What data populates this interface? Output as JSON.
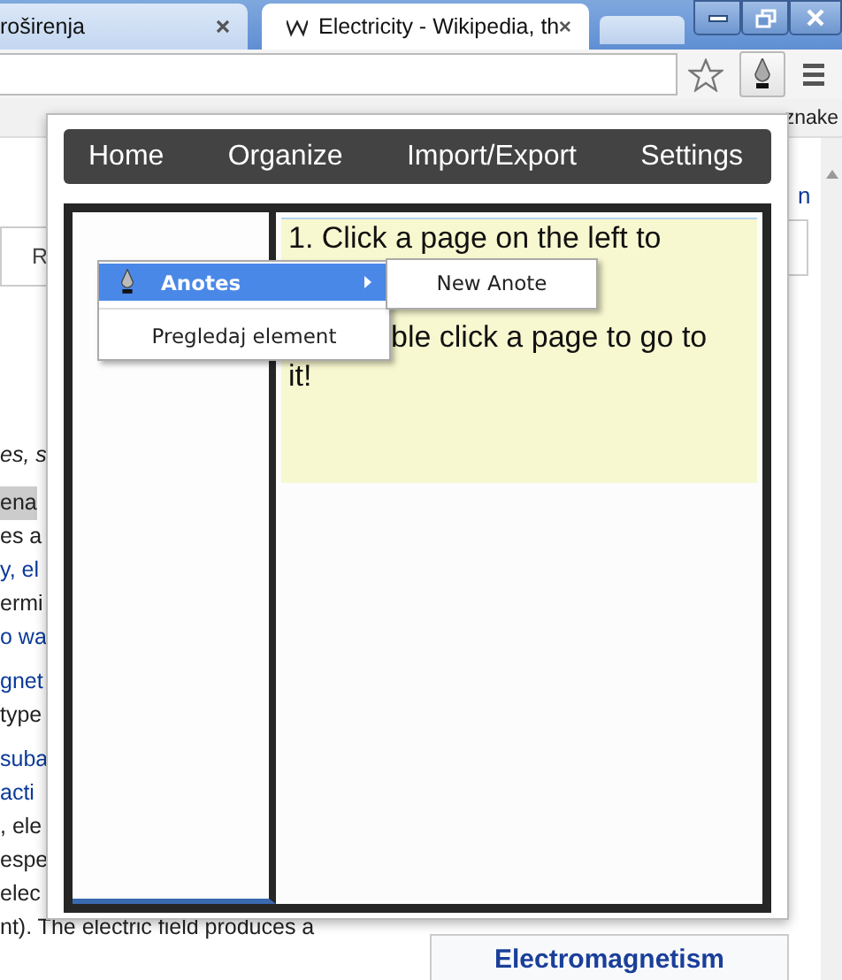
{
  "browser": {
    "tabs": [
      {
        "title": "roširenja",
        "selected": false
      },
      {
        "title": "Electricity - Wikipedia, th",
        "selected": true
      }
    ],
    "bookmarks_bar": {
      "item": "znake"
    }
  },
  "page": {
    "fragments": [
      {
        "text": "R",
        "kind": "box"
      },
      {
        "text": "es, s",
        "kind": "italic"
      },
      {
        "text": "ena",
        "kind": "highlight"
      },
      {
        "text": "es a",
        "kind": "text"
      },
      {
        "text": "y, el",
        "kind": "link"
      },
      {
        "text": "ermi",
        "kind": "text"
      },
      {
        "text": "o wa",
        "kind": "link"
      },
      {
        "text": "gnet",
        "kind": "link"
      },
      {
        "text": "type",
        "kind": "text"
      },
      {
        "text": "suba",
        "kind": "link"
      },
      {
        "text": "acti",
        "kind": "link"
      },
      {
        "text": ", ele",
        "kind": "text"
      },
      {
        "text": "espe",
        "kind": "text"
      },
      {
        "text": "elec",
        "kind": "text"
      },
      {
        "text": "nt). The electric field produces a",
        "kind": "text"
      }
    ],
    "right_fragment": "n",
    "infobox_title": "Electromagnetism"
  },
  "popup": {
    "nav": [
      "Home",
      "Organize",
      "Import/Export",
      "Settings"
    ],
    "note": {
      "lines": [
        {
          "text": "1. Click a page on the left to",
          "kind": "full"
        },
        {
          "text": "ble click a page to go to",
          "kind": "partial"
        },
        {
          "text": "it!",
          "kind": "full"
        }
      ]
    }
  },
  "context_menu": {
    "items": [
      {
        "label": "Anotes",
        "selected": true,
        "submenu": true
      },
      {
        "label": "Pregledaj element",
        "selected": false,
        "submenu": false
      }
    ]
  },
  "submenu": {
    "items": [
      "New Anote"
    ]
  }
}
